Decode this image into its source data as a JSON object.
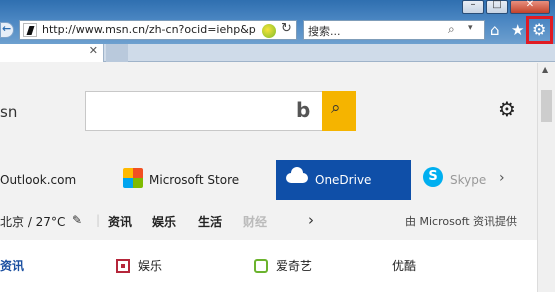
{
  "browser": {
    "url": "http://www.msn.cn/zh-cn?ocid=iehp&p",
    "search_placeholder": "搜索...",
    "window_buttons": {
      "minimize": "–",
      "maximize": "□",
      "close": "✕"
    },
    "tab_close": "✕",
    "icons": {
      "back": "back-arrow-icon",
      "compat": "compatibility-view-icon",
      "refresh": "refresh-icon",
      "search": "search-icon",
      "home": "home-icon",
      "favorites": "star-icon",
      "tools": "gear-icon"
    },
    "highlight_color": "#e01b24"
  },
  "page": {
    "brand": "sn",
    "search_button_color": "#f5b400",
    "tiles": [
      {
        "label": "Outlook.com"
      },
      {
        "label": "Microsoft Store"
      },
      {
        "label": "OneDrive",
        "active": true,
        "color": "#0f4fa8"
      },
      {
        "label": "Skype"
      }
    ],
    "nav": {
      "weather": "北京 / 27°C",
      "items": [
        "资讯",
        "娱乐",
        "生活",
        "财经"
      ],
      "provider": "由 Microsoft 资讯提供"
    },
    "links": [
      "资讯",
      "娱乐",
      "爱奇艺",
      "优酷"
    ]
  }
}
